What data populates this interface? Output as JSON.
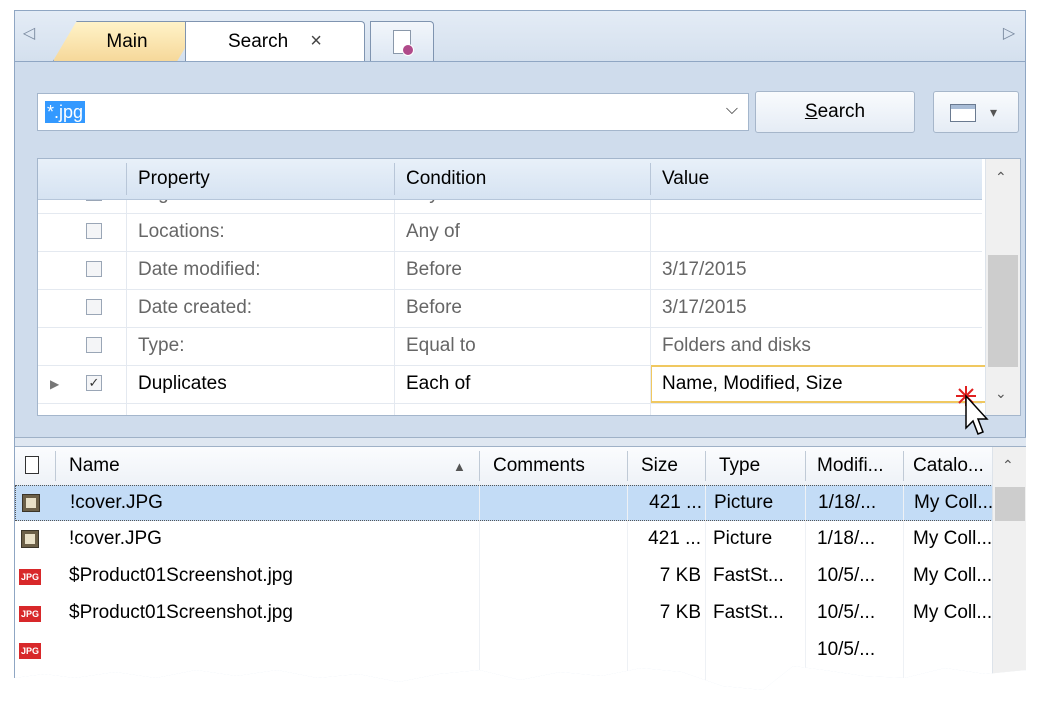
{
  "tabs": {
    "left_arrow": "◁",
    "right_arrow": "▷",
    "main_label": "Main",
    "search_label": "Search",
    "close_glyph": "×"
  },
  "search": {
    "query": "*.jpg",
    "dropdown_glyph": "⌵",
    "button_label": "Search",
    "button_accel": "S",
    "view_arrow": "▾"
  },
  "criteria": {
    "columns": {
      "property": "Property",
      "condition": "Condition",
      "value": "Value"
    },
    "rows": [
      {
        "checked": false,
        "property": "Tags:",
        "condition": "Any of",
        "value": ""
      },
      {
        "checked": false,
        "property": "Locations:",
        "condition": "Any of",
        "value": ""
      },
      {
        "checked": false,
        "property": "Date modified:",
        "condition": "Before",
        "value": "3/17/2015"
      },
      {
        "checked": false,
        "property": "Date created:",
        "condition": "Before",
        "value": "3/17/2015"
      },
      {
        "checked": false,
        "property": "Type:",
        "condition": "Equal to",
        "value": "Folders and disks"
      },
      {
        "checked": true,
        "property": "Duplicates",
        "condition": "Each of",
        "value": "Name, Modified, Size"
      }
    ],
    "current_row_marker": "▶",
    "check_glyph": "✓",
    "scroll_up": "⌃",
    "scroll_down": "⌄"
  },
  "results": {
    "columns": {
      "name": "Name",
      "sort_glyph": "▲",
      "comments": "Comments",
      "size": "Size",
      "type": "Type",
      "modified": "Modifi...",
      "catalog": "Catalo..."
    },
    "rows": [
      {
        "icon": "picture-icon",
        "name": "!cover.JPG",
        "comments": "",
        "size": "421 ...",
        "type": "Picture",
        "modified": "1/18/...",
        "catalog": "My Coll..."
      },
      {
        "icon": "picture-icon",
        "name": "!cover.JPG",
        "comments": "",
        "size": "421 ...",
        "type": "Picture",
        "modified": "1/18/...",
        "catalog": "My Coll..."
      },
      {
        "icon": "jpg-icon",
        "name": "$Product01Screenshot.jpg",
        "comments": "",
        "size": "7 KB",
        "type": "FastSt...",
        "modified": "10/5/...",
        "catalog": "My Coll..."
      },
      {
        "icon": "jpg-icon",
        "name": "$Product01Screenshot.jpg",
        "comments": "",
        "size": "7 KB",
        "type": "FastSt...",
        "modified": "10/5/...",
        "catalog": "My Coll..."
      },
      {
        "icon": "jpg-icon",
        "name": "",
        "comments": "",
        "size": "",
        "type": "",
        "modified": "10/5/...",
        "catalog": ""
      }
    ],
    "jpg_badge": "JPG",
    "scroll_up": "⌃"
  },
  "colors": {
    "selection": "#3399ff",
    "row_selected": "#c3dcf6",
    "tab_active": "#f6d89a",
    "editor_border": "#f0c860"
  }
}
